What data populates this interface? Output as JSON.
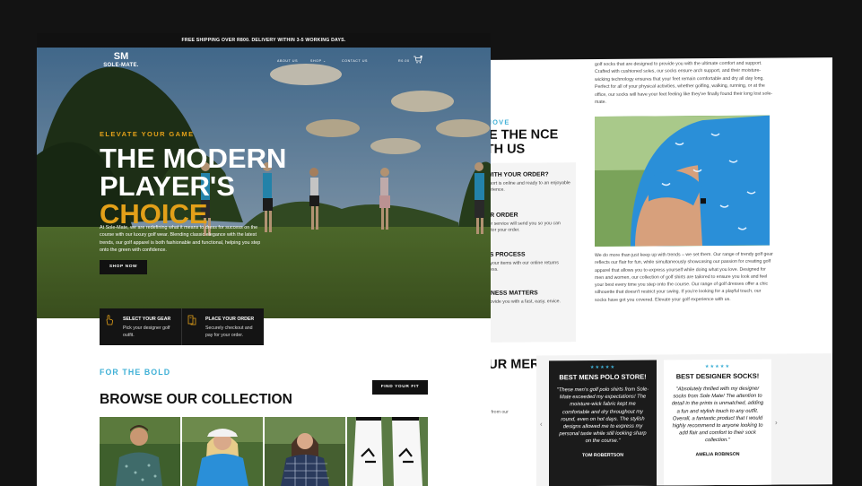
{
  "back_page": {
    "intro_text": "golf socks that are designed to provide you with the ultimate comfort and support. Crafted with cushioned soles, our socks ensure arch support, and their moisture-wicking technology ensures that your feet remain comfortable and dry all day long. Perfect for all of your physical activities, whether golfing, walking, running, or at the office, our socks will have your feet feeling like they've finally found their long lost sole-mate.",
    "eyebrow": "RT MOVE",
    "title": "NCE THE NCE WITH US",
    "cards": [
      {
        "title": "P WITH YOUR ORDER?",
        "text": "Support is online and ready to an enjoyable experience."
      },
      {
        "title": "OUR ORDER",
        "text": "ourier service will send you so you can monitor your order."
      },
      {
        "title": "RNS PROCESS",
        "text": "turn your items with our online returns process."
      },
      {
        "title": "PPINESS MATTERS",
        "text": "to provide you with a fast, easy, ervice."
      }
    ],
    "body_text": "We do more than just keep up with trends – we set them. Our range of trendy golf gear reflects our flair for fun, while simultaneously showcasing our passion for creating golf apparel that allows you to express yourself while doing what you love. Designed for men and women, our collection of golf shirts are tailored to ensure you look and feel your best every time you step onto the course. Our range of golf dresses offer a chic silhouette that doesn't restrict your swing. If you're looking for a playful touch, our socks have got you covered. Elevate your golf experience with us.",
    "customers_title": "OUR MERS",
    "customers_sub": "ces from our",
    "reviews": [
      {
        "stars": "★★★★★",
        "title": "BEST MENS POLO STORE!",
        "quote": "\"These men's golf polo shirts from Sole-Mate exceeded my expectations! The moisture-wick fabric kept me comfortable and dry throughout my round, even on hot days. The stylish designs allowed me to express my personal taste while still looking sharp on the course.\"",
        "name": "TOM ROBERTSON"
      },
      {
        "stars": "★★★★★",
        "title": "BEST DESIGNER SOCKS!",
        "quote": "\"Absolutely thrilled with my designer socks from Sole Mate! The attention to detail in the prints is unmatched, adding a fun and stylish touch to any outfit. Overall, a fantastic product that I would highly recommend to anyone looking to add flair and comfort to their sock collection.\"",
        "name": "AMELIA ROBINSON"
      }
    ],
    "arrows": {
      "prev": "‹",
      "next": "›"
    }
  },
  "front_page": {
    "promo_bar": "FREE SHIPPING OVER R800. DELIVERY WITHIN 3-5 WORKING DAYS.",
    "logo": {
      "mark": "SM",
      "text": "SOLE-MATE."
    },
    "nav": {
      "about": "ABOUT US",
      "shop": "SHOP ⌄",
      "contact": "CONTACT US",
      "cart_amount": "R0.00",
      "cart_count": "0"
    },
    "hero": {
      "eyebrow": "ELEVATE YOUR GAME",
      "title_line1": "THE MODERN",
      "title_line2": "PLAYER'S",
      "title_line3": "CHOICE",
      "description": "At Sole-Mate, we are redefining what it means to dress for success on the course with our luxury golf wear. Blending classic elegance with the latest trends, our golf apparel is both fashionable and functional, helping you step onto the green with confidence.",
      "cta": "SHOP NOW"
    },
    "steps": [
      {
        "icon": "hand-pointer-icon",
        "title": "SELECT YOUR GEAR",
        "text": "Pick your designer golf outfit."
      },
      {
        "icon": "checkout-icon",
        "title": "PLACE YOUR ORDER",
        "text": "Securely checkout and pay for your order."
      }
    ],
    "collection": {
      "eyebrow": "FOR THE BOLD",
      "title": "BROWSE OUR COLLECTION",
      "cta": "FIND YOUR FIT"
    }
  },
  "colors": {
    "gold": "#e2a019",
    "blue": "#3fb0d6",
    "dark": "#111111"
  }
}
